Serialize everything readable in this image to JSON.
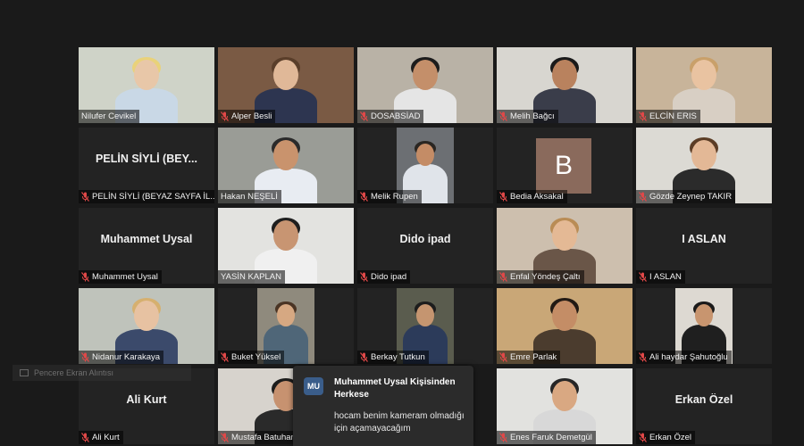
{
  "participants": [
    {
      "name": "Nilufer Cevikel",
      "muted": false,
      "video": true,
      "bg": "#cfd3c8",
      "skin": "#e8c7a8",
      "hair": "#e9d27a",
      "shirt": "#c9d8e6"
    },
    {
      "name": "Alper Besli",
      "muted": true,
      "video": true,
      "bg": "#7a5a44",
      "skin": "#e0b898",
      "hair": "#5a3e2a",
      "shirt": "#2d3550"
    },
    {
      "name": "DOSABSİAD",
      "muted": true,
      "video": true,
      "bg": "#b9b2a6",
      "skin": "#c48f6a",
      "hair": "#1c1c1c",
      "shirt": "#e5e5e5"
    },
    {
      "name": "Melih Bağcı",
      "muted": true,
      "video": true,
      "bg": "#d8d6d0",
      "skin": "#b9825e",
      "hair": "#1a1a1a",
      "shirt": "#3a3d4a"
    },
    {
      "name": "ELCİN ERIS",
      "muted": true,
      "video": true,
      "bg": "#c8b49a",
      "skin": "#e9c3a1",
      "hair": "#c9a06a",
      "shirt": "#d8cfc4"
    },
    {
      "name": "PELİN SİYLİ (BEYAZ SAYFA İL...",
      "card": "PELİN SİYLİ (BEY...",
      "muted": true,
      "video": false
    },
    {
      "name": "Hakan NEŞELİ",
      "muted": false,
      "video": true,
      "speaking": true,
      "bg": "#9a9c96",
      "skin": "#c9936d",
      "hair": "#2a2a2a",
      "shirt": "#e8ecf2"
    },
    {
      "name": "Melik Rupen",
      "muted": true,
      "video": true,
      "inset": true,
      "bg": "#6c6f73",
      "skin": "#c48c66",
      "hair": "#2a2622",
      "shirt": "#e0e4ea"
    },
    {
      "name": "Bedia Aksakal",
      "muted": true,
      "video": false,
      "avatar": "B"
    },
    {
      "name": "Gözde Zeynep TAKIR",
      "muted": true,
      "video": true,
      "bg": "#dcdad4",
      "skin": "#e3b896",
      "hair": "#5b3d26",
      "shirt": "#2b2b2b"
    },
    {
      "name": "Muhammet Uysal",
      "card": "Muhammet Uysal",
      "muted": true,
      "video": false
    },
    {
      "name": "YASİN KAPLAN",
      "muted": false,
      "video": true,
      "bg": "#e3e3e0",
      "skin": "#c89572",
      "hair": "#1e1e1e",
      "shirt": "#f0f0f0"
    },
    {
      "name": "Dido ipad",
      "card": "Dido ipad",
      "muted": true,
      "video": false
    },
    {
      "name": "Enfal Yöndeş Çaltı",
      "muted": true,
      "video": true,
      "bg": "#cdbfae",
      "skin": "#e4b995",
      "hair": "#b98c55",
      "shirt": "#6a5648"
    },
    {
      "name": "I ASLAN",
      "card": "I ASLAN",
      "muted": true,
      "video": false
    },
    {
      "name": "Nidanur Karakaya",
      "muted": true,
      "video": true,
      "bg": "#bfc3bb",
      "skin": "#e7c2a2",
      "hair": "#d6b06f",
      "shirt": "#3b4a6b"
    },
    {
      "name": "Buket Yüksel",
      "muted": true,
      "video": true,
      "inset": true,
      "bg": "#8f8a7d",
      "skin": "#d6a882",
      "hair": "#4a3424",
      "shirt": "#4f6678"
    },
    {
      "name": "Berkay Tutkun",
      "muted": true,
      "video": true,
      "inset": true,
      "bg": "#5a5c4e",
      "skin": "#c59570",
      "hair": "#1d1d1d",
      "shirt": "#2c3b5a"
    },
    {
      "name": "Emre Parlak",
      "muted": true,
      "video": true,
      "bg": "#c9a777",
      "skin": "#c48d66",
      "hair": "#221a14",
      "shirt": "#4b3c2e"
    },
    {
      "name": "Ali haydar Şahutoğlu",
      "muted": true,
      "video": true,
      "inset": true,
      "bg": "#ddd9d2",
      "skin": "#c8956f",
      "hair": "#1a1a1a",
      "shirt": "#1f1f1f"
    },
    {
      "name": "Ali Kurt",
      "card": "Ali Kurt",
      "muted": true,
      "video": false
    },
    {
      "name": "Mustafa Batuhan",
      "muted": true,
      "video": true,
      "bg": "#d7d3cd",
      "skin": "#c79270",
      "hair": "#1c1c1c",
      "shirt": "#2a2a2a"
    },
    {
      "name": "",
      "muted": false,
      "video": false,
      "hidden": true
    },
    {
      "name": "Enes Faruk Demetgül",
      "muted": true,
      "video": true,
      "bg": "#e2e2df",
      "skin": "#d9a882",
      "hair": "#262626",
      "shirt": "#d8d8d8"
    },
    {
      "name": "Erkan Özel",
      "card": "Erkan Özel",
      "muted": true,
      "video": false
    }
  ],
  "chat_popup": {
    "badge": "MU",
    "from": "Muhammet Uysal Kişisinden Herkese",
    "message": "hocam benim kameram olmadığı için açamayacağım"
  },
  "ghost_window": {
    "label": "Pencere Ekran Alıntısı"
  },
  "colors": {
    "speaking_border": "#d8e36b",
    "muted_mic": "#e04848",
    "avatar_bg": "#8a6a5c"
  },
  "icons": {
    "muted": "mic-muted-icon"
  }
}
